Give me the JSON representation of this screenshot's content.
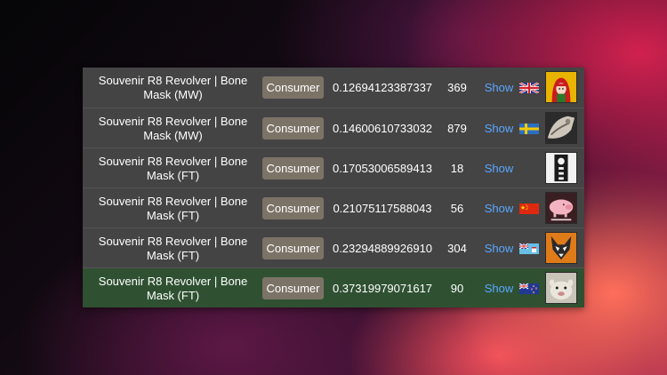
{
  "rows": [
    {
      "name": "Souvenir R8 Revolver | Bone Mask (MW)",
      "type_label": "Consumer",
      "value": "0.12694123387337",
      "count": "369",
      "action": "Show",
      "flag": "gb-flag-icon",
      "avatar": "red-hood-avatar"
    },
    {
      "name": "Souvenir R8 Revolver | Bone Mask (MW)",
      "type_label": "Consumer",
      "value": "0.14600610733032",
      "count": "879",
      "action": "Show",
      "flag": "se-flag-icon",
      "avatar": "grayscale-figure-avatar"
    },
    {
      "name": "Souvenir R8 Revolver | Bone Mask (FT)",
      "type_label": "Consumer",
      "value": "0.17053006589413",
      "count": "18",
      "action": "Show",
      "flag": "",
      "avatar": "black-white-figure-avatar"
    },
    {
      "name": "Souvenir R8 Revolver | Bone Mask (FT)",
      "type_label": "Consumer",
      "value": "0.21075117588043",
      "count": "56",
      "action": "Show",
      "flag": "cn-flag-icon",
      "avatar": "pink-pig-avatar"
    },
    {
      "name": "Souvenir R8 Revolver | Bone Mask (FT)",
      "type_label": "Consumer",
      "value": "0.23294889926910",
      "count": "304",
      "action": "Show",
      "flag": "fj-flag-icon",
      "avatar": "orange-wolf-avatar"
    },
    {
      "name": "Souvenir R8 Revolver | Bone Mask (FT)",
      "type_label": "Consumer",
      "value": "0.37319979071617",
      "count": "90",
      "action": "Show",
      "flag": "nz-flag-icon",
      "avatar": "pale-creature-avatar"
    }
  ],
  "colors": {
    "panel_bg": "#444444",
    "selected_row_bg": "#2f5132",
    "button_bg": "#7c7367",
    "link": "#5aa7ff"
  }
}
